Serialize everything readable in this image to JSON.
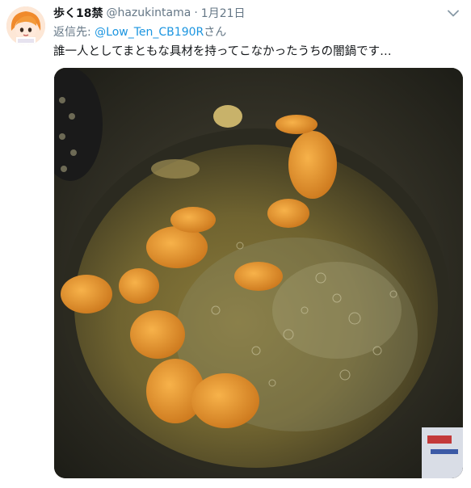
{
  "tweet": {
    "display_name": "歩く18禁",
    "handle": "@hazukintama",
    "separator": "·",
    "timestamp": "1月21日",
    "reply_prefix": "返信先: ",
    "reply_to": "@Low_Ten_CB190R",
    "reply_suffix": "さん",
    "text": "誰一人としてまともな具材を持ってこなかったうちの闇鍋です…"
  },
  "icons": {
    "caret": "chevron-down-icon",
    "avatar": "avatar-cartoon-girl"
  },
  "colors": {
    "link": "#1b95e0",
    "secondary_text": "#657786",
    "primary_text": "#14171a"
  }
}
